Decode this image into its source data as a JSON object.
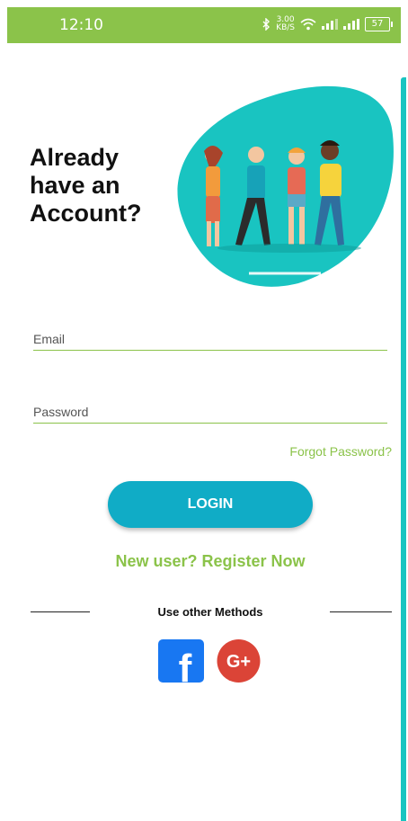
{
  "status_bar": {
    "time": "12:10",
    "net_speed_value": "3.00",
    "net_speed_unit": "KB/S",
    "battery": "57"
  },
  "hero": {
    "title": "Already have an Account?"
  },
  "form": {
    "email_placeholder": "Email",
    "password_placeholder": "Password",
    "forgot_label": "Forgot Password?",
    "login_label": "LOGIN",
    "register_label": "New user? Register Now"
  },
  "social": {
    "other_methods_label": "Use other Methods",
    "facebook_glyph": "f",
    "google_glyph": "G+"
  },
  "colors": {
    "status_bar": "#8bc34a",
    "accent_green": "#8bc34a",
    "teal": "#19c4c1",
    "login_button": "#10acc6",
    "facebook": "#1877f2",
    "google": "#db4437"
  },
  "icons": [
    "bluetooth-icon",
    "wifi-icon",
    "signal-icon",
    "battery-icon",
    "facebook-icon",
    "google-plus-icon"
  ]
}
